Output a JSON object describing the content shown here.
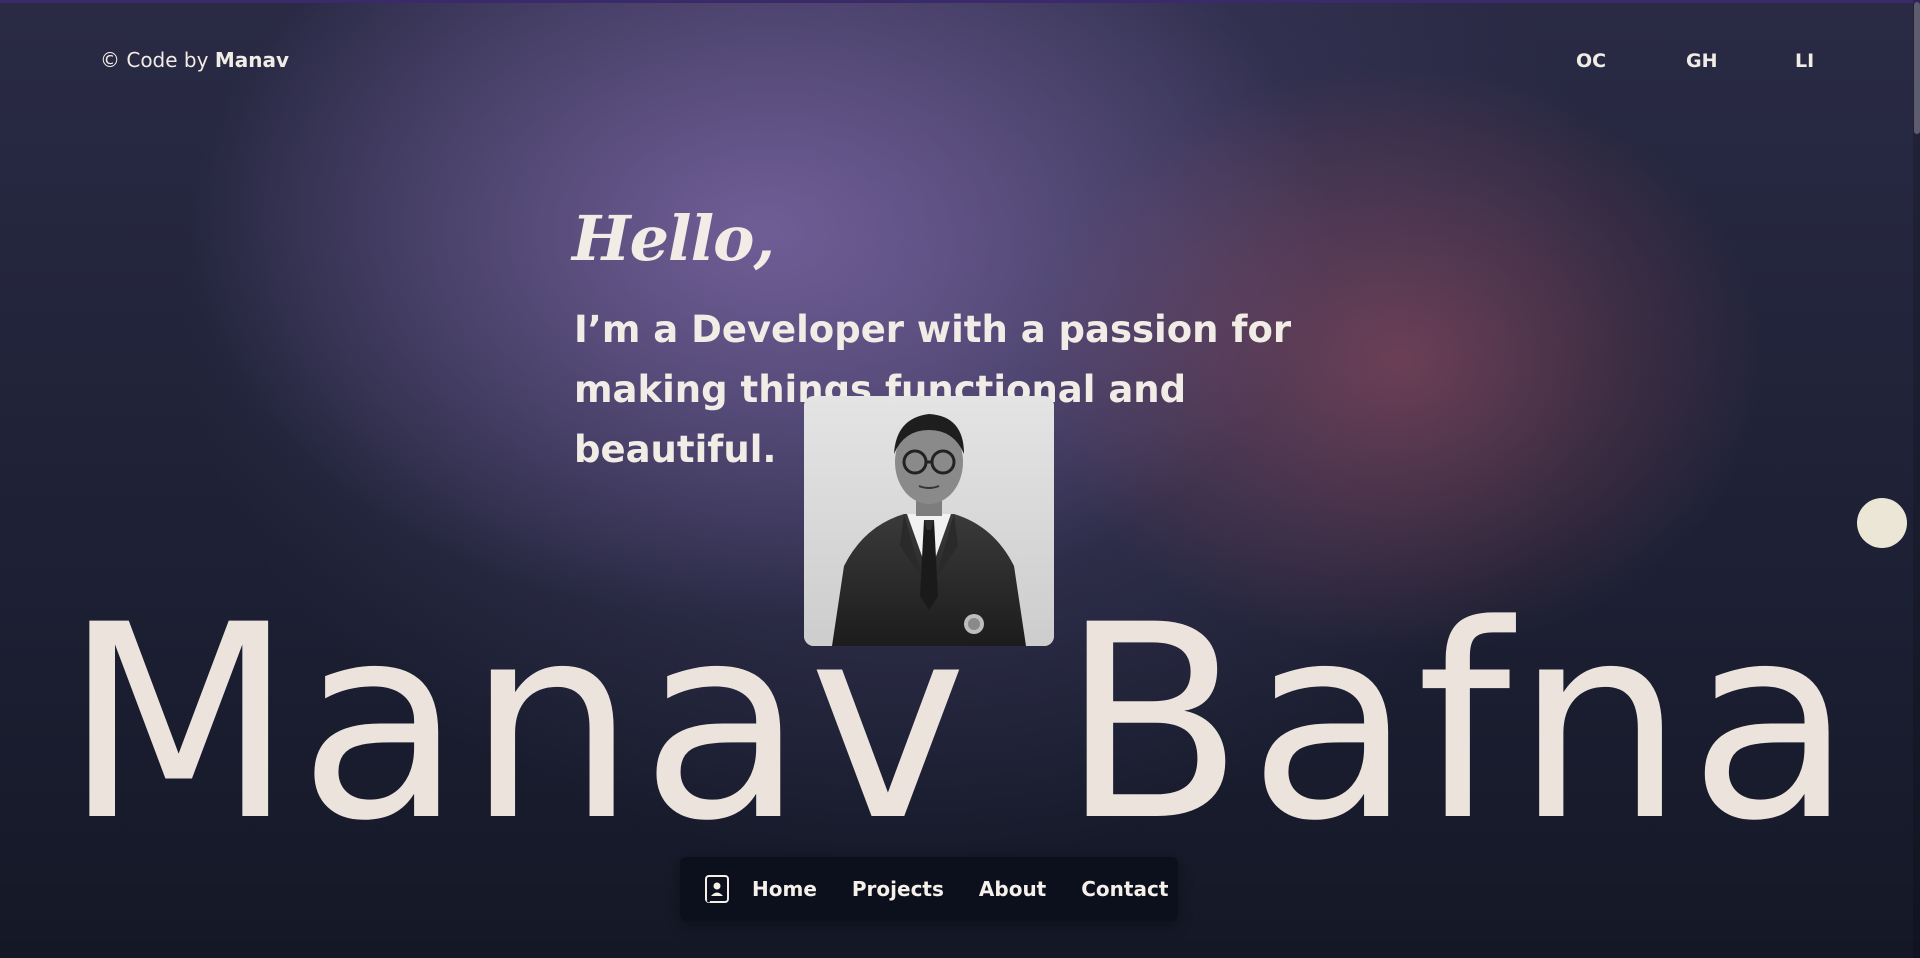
{
  "header": {
    "copyright_prefix": "© Code by ",
    "copyright_name": "Manav"
  },
  "social": [
    {
      "label": "OC"
    },
    {
      "label": "GH"
    },
    {
      "label": "LI"
    }
  ],
  "hero": {
    "greeting": "Hello,",
    "tagline_line1": "I’m a Developer with a passion for",
    "tagline_line2": "making things functional and beautiful.",
    "name": "Manav Bafna"
  },
  "dock": {
    "icon": "contact-card-icon",
    "links": [
      {
        "label": "Home"
      },
      {
        "label": "Projects"
      },
      {
        "label": "About"
      },
      {
        "label": "Contact"
      }
    ]
  },
  "colors": {
    "text": "#f1ece6",
    "dock_bg": "#0c101c",
    "accent_dot": "#ebe6d6"
  }
}
